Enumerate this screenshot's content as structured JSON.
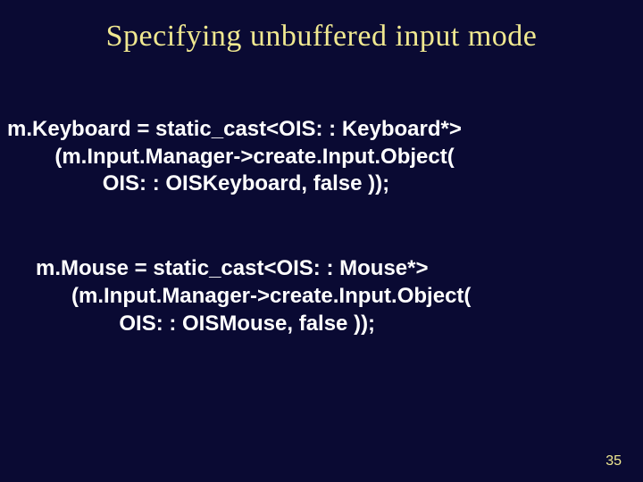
{
  "title": "Specifying unbuffered input mode",
  "code": {
    "keyboard": {
      "l1": "m.Keyboard = static_cast<OIS: : Keyboard*>",
      "l2": "        (m.Input.Manager->create.Input.Object(",
      "l3": "                OIS: : OISKeyboard, false ));"
    },
    "mouse": {
      "l1": "m.Mouse = static_cast<OIS: : Mouse*>",
      "l2": "      (m.Input.Manager->create.Input.Object(",
      "l3": "              OIS: : OISMouse, false ));"
    }
  },
  "page_number": "35"
}
